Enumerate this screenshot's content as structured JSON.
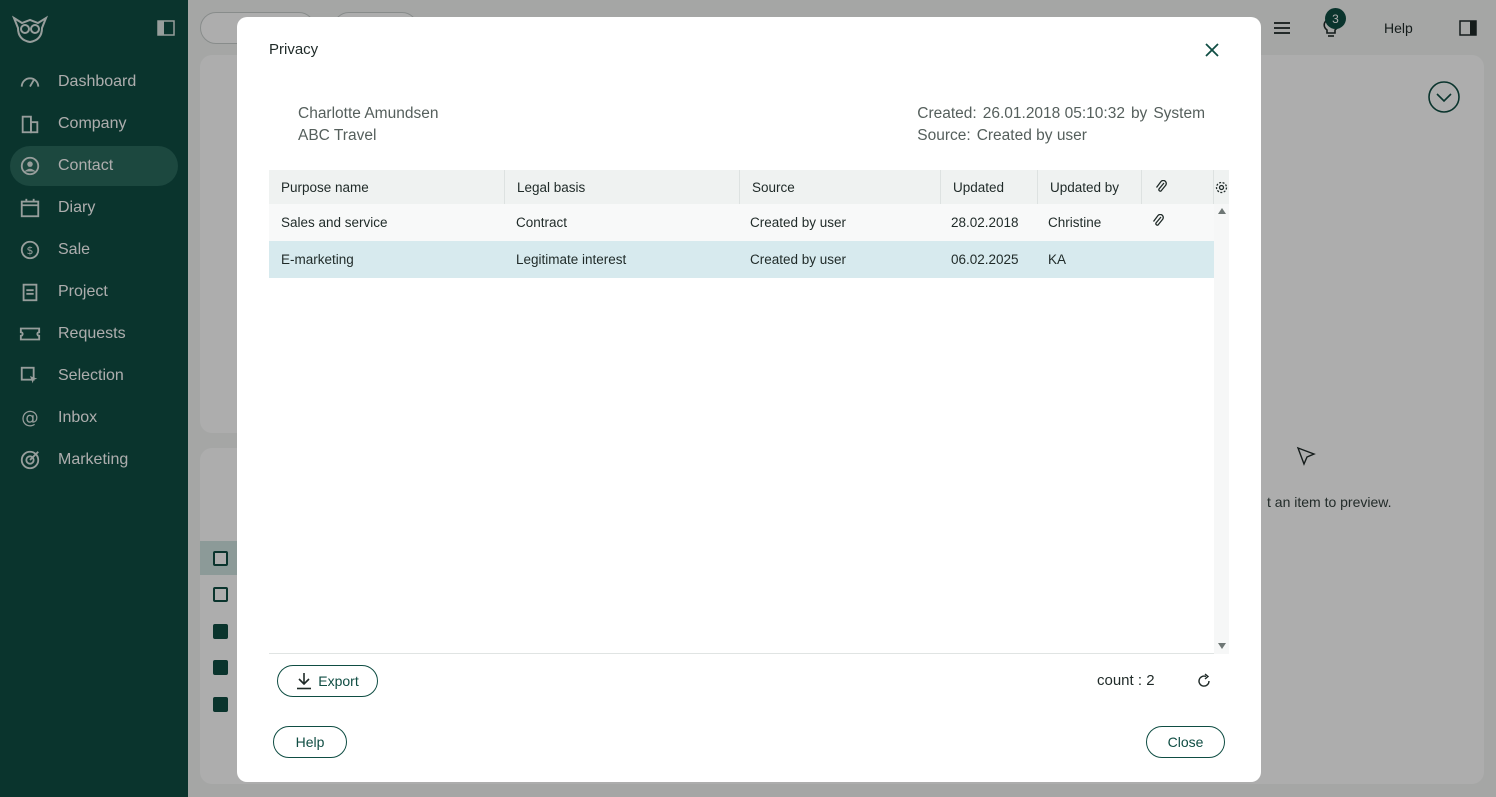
{
  "sidebar": {
    "items": [
      {
        "label": "Dashboard",
        "icon": "dashboard-icon"
      },
      {
        "label": "Company",
        "icon": "company-icon"
      },
      {
        "label": "Contact",
        "icon": "contact-icon",
        "active": true
      },
      {
        "label": "Diary",
        "icon": "diary-icon"
      },
      {
        "label": "Sale",
        "icon": "sale-icon"
      },
      {
        "label": "Project",
        "icon": "project-icon"
      },
      {
        "label": "Requests",
        "icon": "requests-icon"
      },
      {
        "label": "Selection",
        "icon": "selection-icon"
      },
      {
        "label": "Inbox",
        "icon": "inbox-icon"
      },
      {
        "label": "Marketing",
        "icon": "marketing-icon"
      }
    ]
  },
  "background": {
    "notification_count": "3",
    "help_label": "Help",
    "preview_text": "t an item to preview."
  },
  "modal": {
    "title": "Privacy",
    "contact_name": "Charlotte Amundsen",
    "company": "ABC Travel",
    "created_label": "Created:",
    "created_value": "26.01.2018 05:10:32",
    "created_by_label": "by",
    "created_by": "System",
    "source_label": "Source:",
    "source_value": "Created by user",
    "table": {
      "headers": [
        "Purpose name",
        "Legal basis",
        "Source",
        "Updated",
        "Updated by"
      ],
      "rows": [
        {
          "purpose": "Sales and service",
          "legal_basis": "Contract",
          "source": "Created by user",
          "updated": "28.02.2018",
          "updated_by": "Christine",
          "attachment": true
        },
        {
          "purpose": "E-marketing",
          "legal_basis": "Legitimate interest",
          "source": "Created by user",
          "updated": "06.02.2025",
          "updated_by": "KA",
          "attachment": false
        }
      ]
    },
    "export_label": "Export",
    "count_text": "count : 2",
    "help_label": "Help",
    "close_label": "Close"
  },
  "colors": {
    "brand": "#0f4d43",
    "selected_row": "#d7eaee"
  }
}
